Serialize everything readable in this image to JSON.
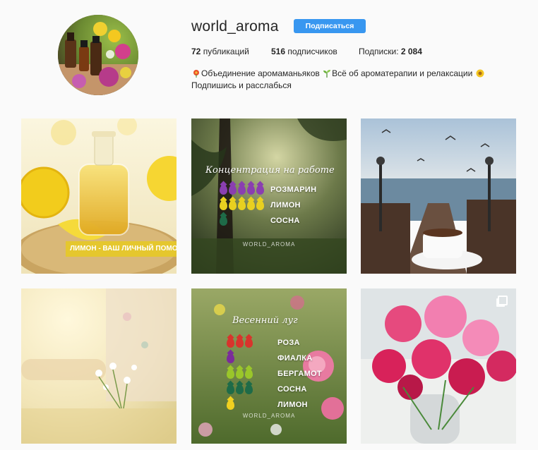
{
  "profile": {
    "username": "world_aroma",
    "follow_label": "Подписаться",
    "stats": {
      "posts_count": "72",
      "posts_label": "публикаций",
      "followers_count": "516",
      "followers_label": "подписчиков",
      "following_label": "Подписки:",
      "following_count": "2 084"
    },
    "bio_line1": "Объединение аромаманьяков",
    "bio_line1b": "Всё об ароматерапии и релаксации",
    "bio_line2": "Подпишись и расслабься"
  },
  "posts": {
    "p1": {
      "banner": "ЛИМОН - ВАШ ЛИЧНЫЙ ПОМОЩНИК"
    },
    "p2": {
      "title": "Концентрация на работе",
      "aromas": [
        {
          "name": "РОЗМАРИН",
          "color": "#8a3fb0",
          "count": 5
        },
        {
          "name": "ЛИМОН",
          "color": "#e8d020",
          "count": 5
        },
        {
          "name": "СОСНА",
          "color": "#1e6b48",
          "count": 1
        }
      ],
      "watermark": "WORLD_AROMA"
    },
    "p5": {
      "title": "Весенний луг",
      "aromas": [
        {
          "name": "РОЗА",
          "color": "#d8342c",
          "count": 3
        },
        {
          "name": "ФИАЛКА",
          "color": "#7b2c9a",
          "count": 1
        },
        {
          "name": "БЕРГАМОТ",
          "color": "#9ac62a",
          "count": 3
        },
        {
          "name": "СОСНА",
          "color": "#1e6b48",
          "count": 3
        },
        {
          "name": "ЛИМОН",
          "color": "#f0d020",
          "count": 1
        }
      ],
      "watermark": "WORLD_AROMA"
    }
  },
  "icons": {
    "bio_icons": [
      "flower-icon",
      "seedling-icon",
      "sun-flower-icon"
    ],
    "multi_post": "multiple-photos-icon"
  }
}
